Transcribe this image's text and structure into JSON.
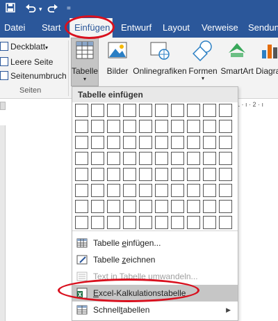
{
  "quick_access": {
    "save_icon": "save-icon",
    "undo_icon": "undo-icon",
    "redo_icon": "redo-icon"
  },
  "tabs": [
    {
      "label": "Datei"
    },
    {
      "label": "Start"
    },
    {
      "label": "Einfügen"
    },
    {
      "label": "Entwurf"
    },
    {
      "label": "Layout"
    },
    {
      "label": "Verweise"
    },
    {
      "label": "Sendun"
    }
  ],
  "ribbon": {
    "pages_group": {
      "items": [
        "Deckblatt",
        "Leere Seite",
        "Seitenumbruch"
      ],
      "label": "Seiten"
    },
    "tabelle_label": "Tabelle",
    "illustrations": [
      {
        "label": "Bilder"
      },
      {
        "label": "Onlinegrafiken"
      },
      {
        "label": "Formen"
      },
      {
        "label": "SmartArt"
      },
      {
        "label": "Diagra"
      }
    ]
  },
  "ruler": {
    "marks": "1 · ı · 2 · ı"
  },
  "panel": {
    "title": "Tabelle einfügen",
    "grid_cols": 10,
    "grid_rows": 8,
    "menu": [
      {
        "pre": "Tabelle ",
        "ul": "e",
        "post": "infügen...",
        "disabled": false
      },
      {
        "pre": "Tabelle ",
        "ul": "z",
        "post": "eichnen",
        "disabled": false
      },
      {
        "pre": "Text ",
        "ul": "i",
        "post": "n Tabelle umwandeln...",
        "disabled": true
      },
      {
        "pre": "",
        "ul": "E",
        "post": "xcel-Kalkulationstabelle",
        "disabled": false
      },
      {
        "pre": "Schnell",
        "ul": "t",
        "post": "abellen",
        "disabled": false
      }
    ]
  },
  "colors": {
    "accent": "#2b579a",
    "highlight_ring": "#d9101e",
    "excel_green": "#1e7145"
  }
}
